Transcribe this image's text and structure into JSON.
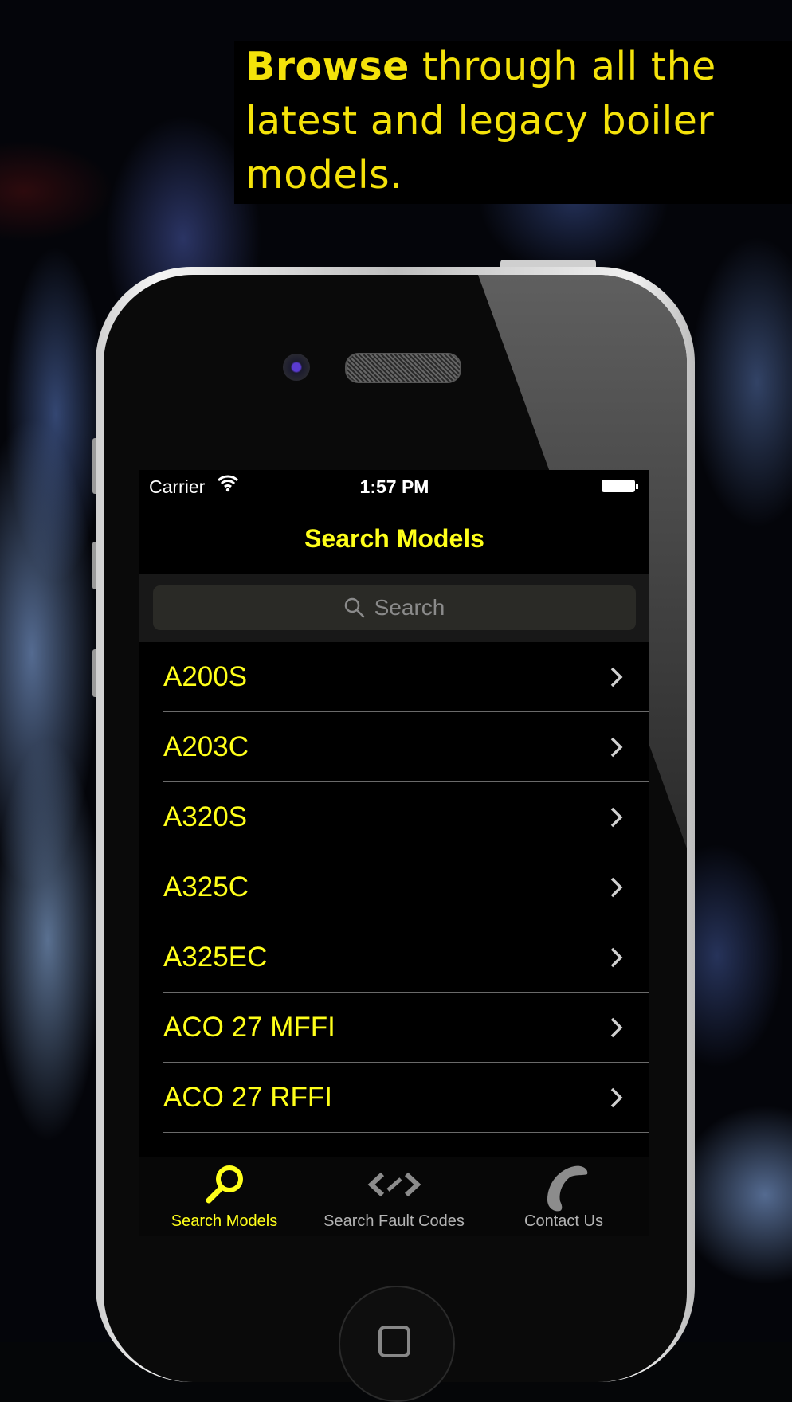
{
  "caption": {
    "bold": "Browse",
    "rest": " through all the latest and legacy boiler models."
  },
  "status_bar": {
    "carrier": "Carrier",
    "time": "1:57 PM"
  },
  "nav": {
    "title": "Search Models"
  },
  "search": {
    "placeholder": "Search"
  },
  "models": [
    {
      "label": "A200S"
    },
    {
      "label": "A203C"
    },
    {
      "label": "A320S"
    },
    {
      "label": "A325C"
    },
    {
      "label": "A325EC"
    },
    {
      "label": "ACO 27 MFFI"
    },
    {
      "label": "ACO 27 RFFI"
    }
  ],
  "tabs": [
    {
      "label": "Search Models",
      "icon": "magnifier-icon",
      "active": true
    },
    {
      "label": "Search Fault Codes",
      "icon": "code-brackets-icon",
      "active": false
    },
    {
      "label": "Contact Us",
      "icon": "phone-handset-icon",
      "active": false
    }
  ],
  "colors": {
    "accent": "#FFFF1A",
    "caption": "#F4E20A",
    "background": "#000000"
  }
}
